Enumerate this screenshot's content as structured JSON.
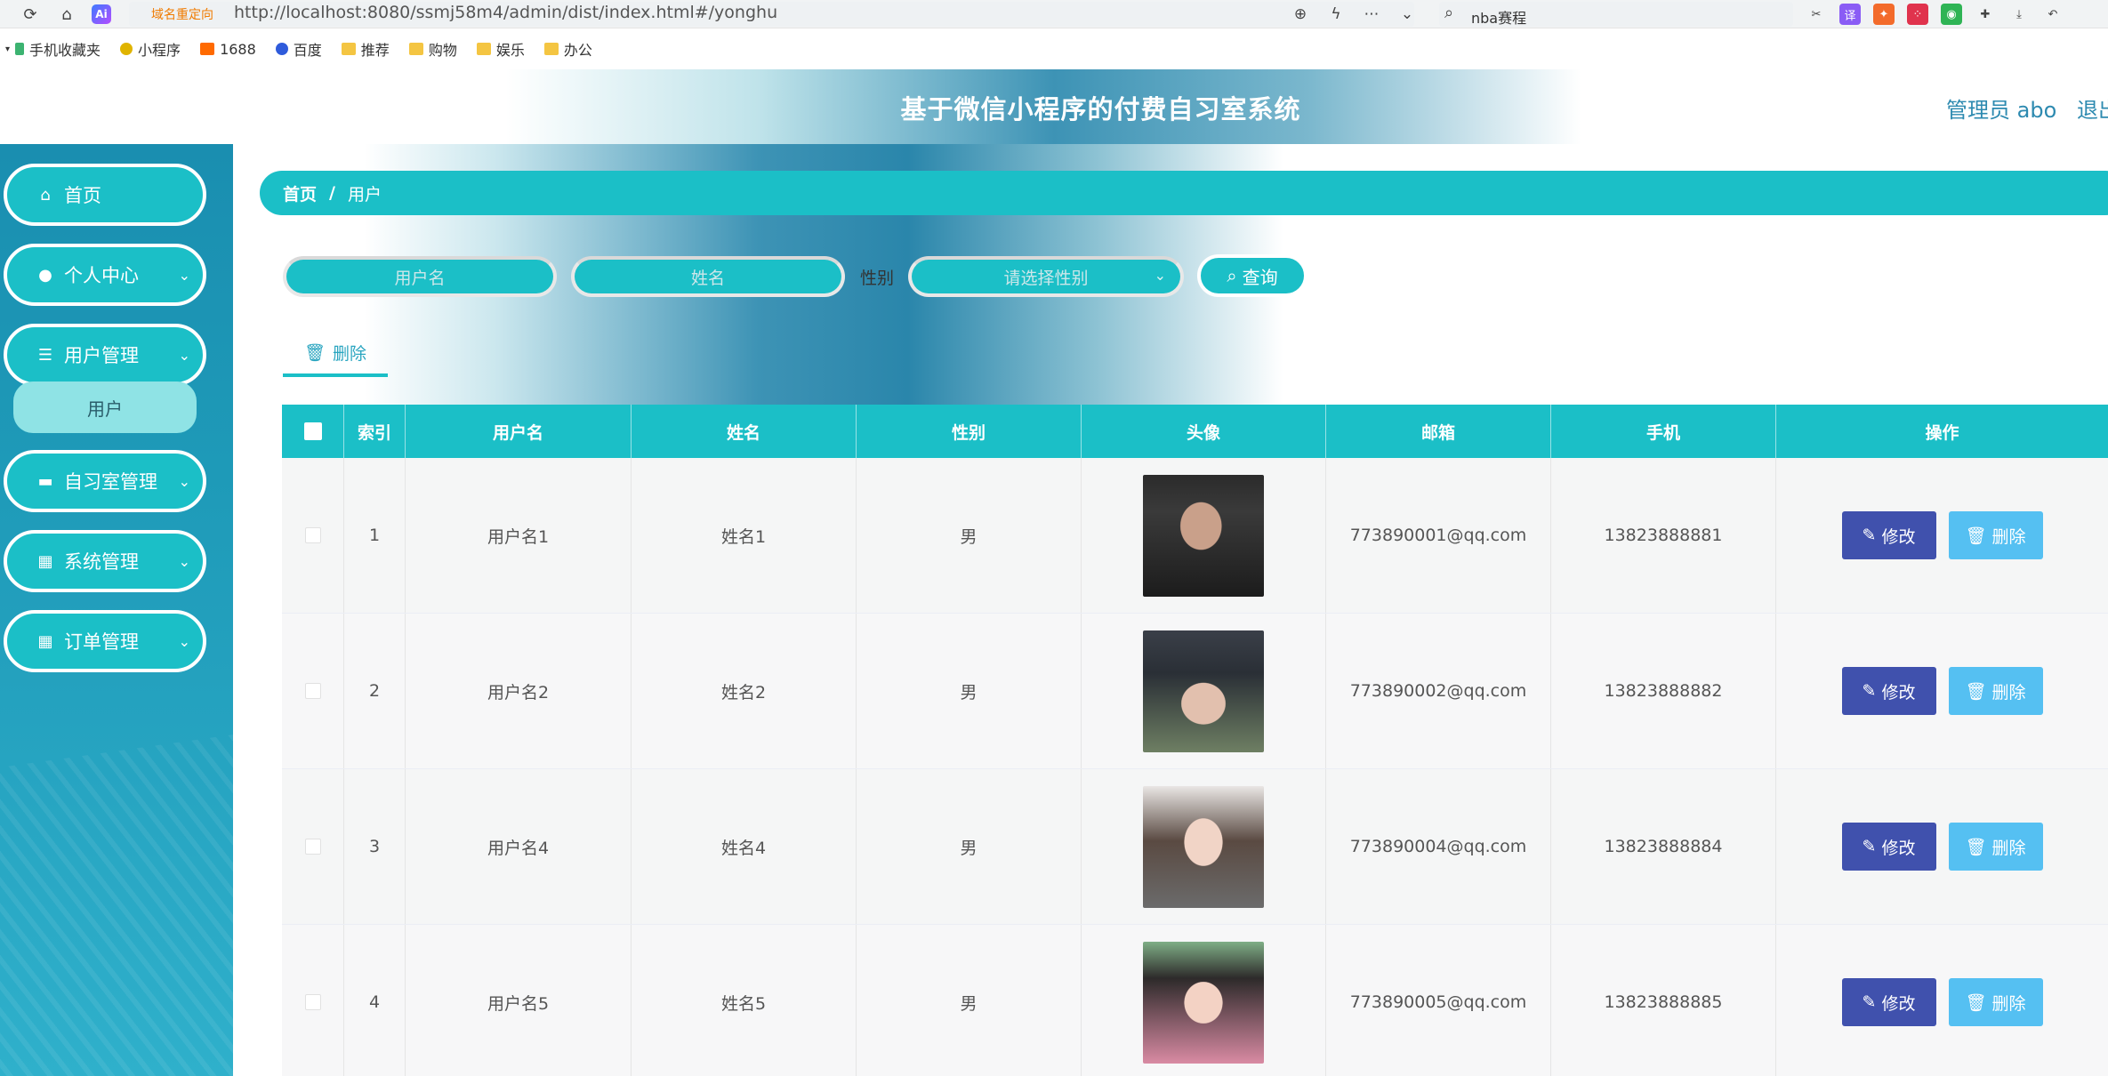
{
  "browser": {
    "url_redirect_tag": "域名重定向",
    "url": "http://localhost:8080/ssmj58m4/admin/dist/index.html#/yonghu",
    "ai_badge": "Ai",
    "search_text": "nba赛程",
    "bookmarks": [
      "手机收藏夹",
      "小程序",
      "1688",
      "百度",
      "推荐",
      "购物",
      "娱乐",
      "办公"
    ]
  },
  "header": {
    "title": "基于微信小程序的付费自习室系统",
    "user": "管理员 abo",
    "logout": "退出"
  },
  "sidebar": {
    "items": [
      {
        "label": "首页",
        "icon": "home-icon"
      },
      {
        "label": "个人中心",
        "icon": "user-icon"
      },
      {
        "label": "用户管理",
        "icon": "list-icon"
      },
      {
        "label": "自习室管理",
        "icon": "monitor-icon"
      },
      {
        "label": "系统管理",
        "icon": "grid-icon"
      },
      {
        "label": "订单管理",
        "icon": "grid-icon"
      }
    ],
    "sub_item": "用户"
  },
  "breadcrumb": {
    "home": "首页",
    "sep": "/",
    "current": "用户"
  },
  "search": {
    "username_placeholder": "用户名",
    "name_placeholder": "姓名",
    "gender_label": "性别",
    "gender_placeholder": "请选择性别",
    "query_label": "查询"
  },
  "toolbar": {
    "delete_label": "删除"
  },
  "table": {
    "headers": [
      "索引",
      "用户名",
      "姓名",
      "性别",
      "头像",
      "邮箱",
      "手机",
      "操作"
    ],
    "rows": [
      {
        "index": "1",
        "username": "用户名1",
        "name": "姓名1",
        "gender": "男",
        "email": "773890001@qq.com",
        "phone": "13823888881"
      },
      {
        "index": "2",
        "username": "用户名2",
        "name": "姓名2",
        "gender": "男",
        "email": "773890002@qq.com",
        "phone": "13823888882"
      },
      {
        "index": "3",
        "username": "用户名4",
        "name": "姓名4",
        "gender": "男",
        "email": "773890004@qq.com",
        "phone": "13823888884"
      },
      {
        "index": "4",
        "username": "用户名5",
        "name": "姓名5",
        "gender": "男",
        "email": "773890005@qq.com",
        "phone": "13823888885"
      }
    ],
    "edit_label": "修改",
    "delete_label": "删除"
  },
  "colors": {
    "accent": "#1bbfc7",
    "edit": "#4051ad",
    "delete": "#55c0f2"
  }
}
